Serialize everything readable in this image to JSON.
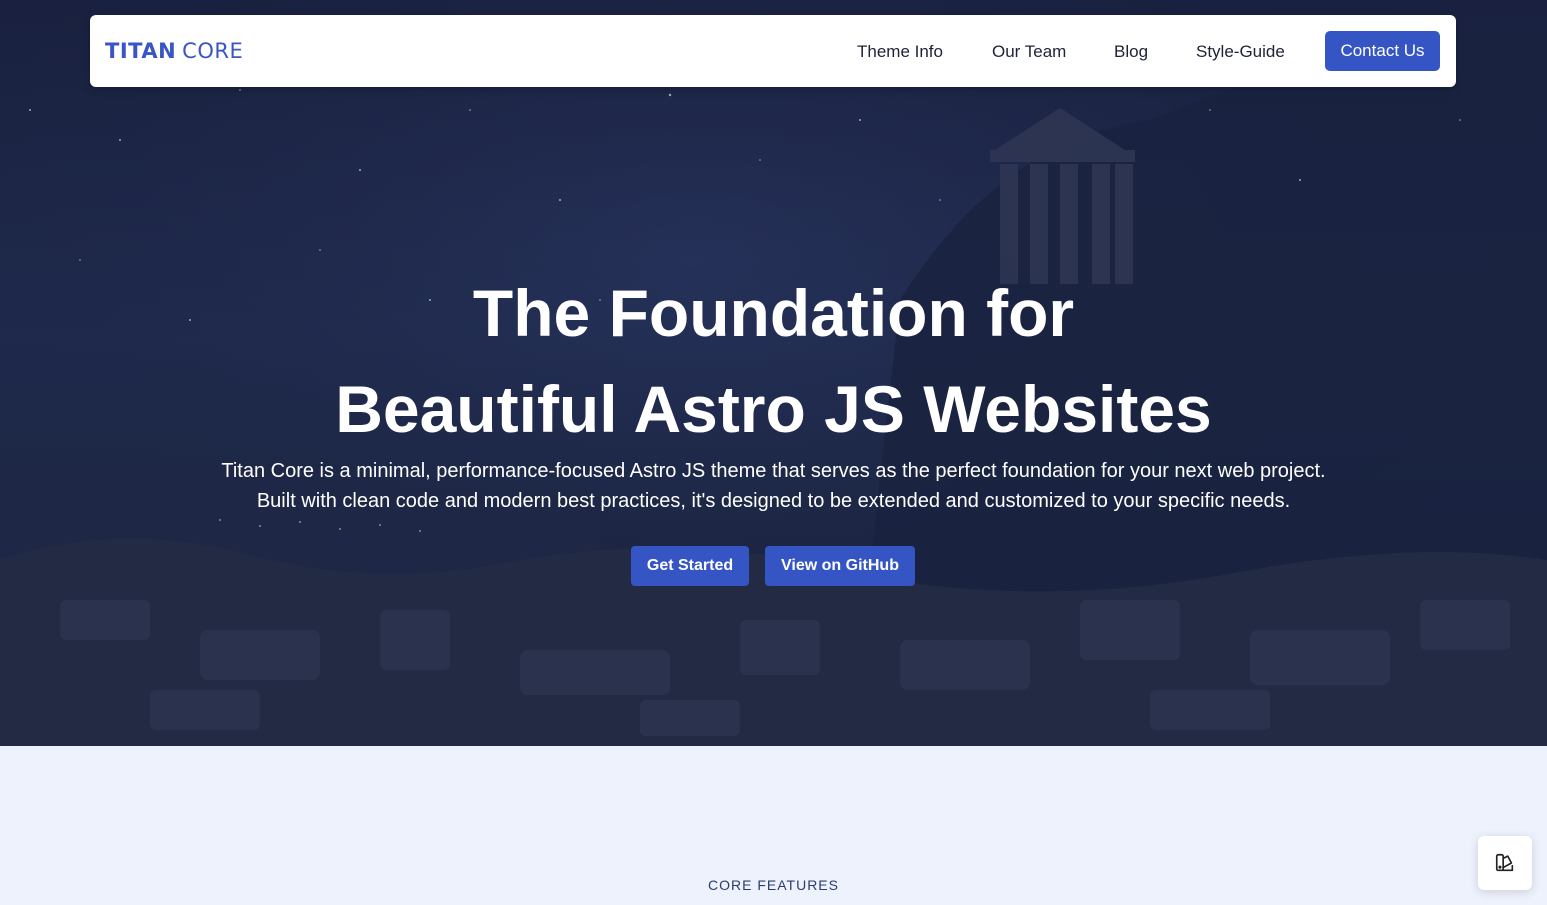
{
  "navbar": {
    "logo_primary": "TITAN",
    "logo_secondary": "CORE",
    "links": [
      "Theme Info",
      "Our Team",
      "Blog",
      "Style-Guide"
    ],
    "cta_label": "Contact Us"
  },
  "hero": {
    "title_line1": "The Foundation for",
    "title_line2": "Beautiful Astro JS Websites",
    "desc_line1": "Titan Core is a minimal, performance-focused Astro JS theme that serves as the perfect foundation for your next web project.",
    "desc_line2": "Built with clean code and modern best practices, it's designed to be extended and customized to your specific needs.",
    "primary_button": "Get Started",
    "secondary_button": "View on GitHub"
  },
  "features": {
    "eyebrow": "CORE FEATURES"
  },
  "theme_toggle": {
    "icon": "palette-icon"
  },
  "colors": {
    "accent": "#3555c5",
    "hero_bg": "#1f2a4d",
    "section_bg": "#eef2fc",
    "nav_text": "#1d2336"
  }
}
